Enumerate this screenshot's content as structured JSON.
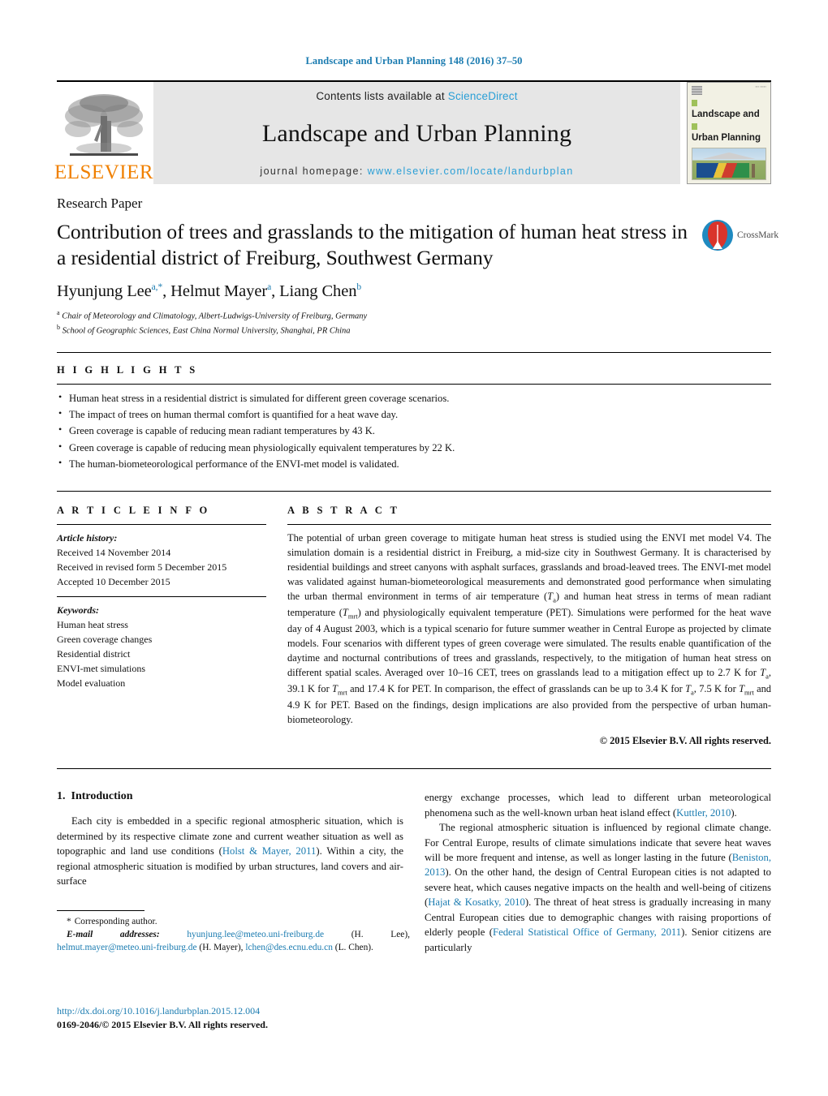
{
  "running_head": "Landscape and Urban Planning 148 (2016) 37–50",
  "masthead": {
    "publisher_logo_text": "ELSEVIER",
    "contents_prefix": "Contents lists available at ",
    "contents_link": "ScienceDirect",
    "journal_name": "Landscape and Urban Planning",
    "homepage_prefix": "journal homepage: ",
    "homepage_url": "www.elsevier.com/locate/landurbplan",
    "cover_title_line1": "Landscape and",
    "cover_title_line2": "Urban Planning"
  },
  "article": {
    "type": "Research Paper",
    "title": "Contribution of trees and grasslands to the mitigation of human heat stress in a residential district of Freiburg, Southwest Germany",
    "crossmark_label": "CrossMark",
    "authors_html": "Hyunjung Lee<sup>a,</sup><sup>*</sup>, Helmut Mayer<sup>a</sup>, Liang Chen<sup>b</sup>",
    "affiliations": [
      {
        "marker": "a",
        "text": "Chair of Meteorology and Climatology, Albert-Ludwigs-University of Freiburg, Germany"
      },
      {
        "marker": "b",
        "text": "School of Geographic Sciences, East China Normal University, Shanghai, PR China"
      }
    ]
  },
  "highlights": {
    "heading": "H I G H L I G H T S",
    "items": [
      "Human heat stress in a residential district is simulated for different green coverage scenarios.",
      "The impact of trees on human thermal comfort is quantified for a heat wave day.",
      "Green coverage is capable of reducing mean radiant temperatures by 43 K.",
      "Green coverage is capable of reducing mean physiologically equivalent temperatures by 22 K.",
      "The human-biometeorological performance of the ENVI-met model is validated."
    ]
  },
  "article_info": {
    "heading": "A R T I C L E   I N F O",
    "history_label": "Article history:",
    "history": [
      "Received 14 November 2014",
      "Received in revised form 5 December 2015",
      "Accepted 10 December 2015"
    ],
    "keywords_label": "Keywords:",
    "keywords": [
      "Human heat stress",
      "Green coverage changes",
      "Residential district",
      "ENVI-met simulations",
      "Model evaluation"
    ]
  },
  "abstract": {
    "heading": "A B S T R A C T",
    "text_html": "The potential of urban green coverage to mitigate human heat stress is studied using the ENVI met model V4. The simulation domain is a residential district in Freiburg, a mid-size city in Southwest Germany. It is characterised by residential buildings and street canyons with asphalt surfaces, grasslands and broad-leaved trees. The ENVI-met model was validated against human-biometeorological measurements and demonstrated good performance when simulating the urban thermal environment in terms of air temperature (<i>T</i><sub>a</sub>) and human heat stress in terms of mean radiant temperature (<i>T</i><sub>mrt</sub>) and physiologically equivalent temperature (PET). Simulations were performed for the heat wave day of 4 August 2003, which is a typical scenario for future summer weather in Central Europe as projected by climate models. Four scenarios with different types of green coverage were simulated. The results enable quantification of the daytime and nocturnal contributions of trees and grasslands, respectively, to the mitigation of human heat stress on different spatial scales. Averaged over 10–16 CET, trees on grasslands lead to a mitigation effect up to 2.7 K for <i>T</i><sub>a</sub>, 39.1 K for <i>T</i><sub>mrt</sub> and 17.4 K for PET. In comparison, the effect of grasslands can be up to 3.4 K for <i>T</i><sub>a</sub>, 7.5 K for <i>T</i><sub>mrt</sub> and 4.9 K for PET. Based on the findings, design implications are also provided from the perspective of urban human-biometeorology.",
    "copyright": "© 2015 Elsevier B.V. All rights reserved."
  },
  "introduction": {
    "number": "1.",
    "heading": "Introduction",
    "col_left_html": "Each city is embedded in a specific regional atmospheric situation, which is determined by its respective climate zone and current weather situation as well as topographic and land use conditions (<span class=\"ref\">Holst &amp; Mayer, 2011</span>). Within a city, the regional atmospheric situation is modified by urban structures, land covers and air-surface",
    "col_right_p1_html": "energy exchange processes, which lead to different urban meteorological phenomena such as the well-known urban heat island effect (<span class=\"ref\">Kuttler, 2010</span>).",
    "col_right_p2_html": "The regional atmospheric situation is influenced by regional climate change. For Central Europe, results of climate simulations indicate that severe heat waves will be more frequent and intense, as well as longer lasting in the future (<span class=\"ref\">Beniston, 2013</span>). On the other hand, the design of Central European cities is not adapted to severe heat, which causes negative impacts on the health and well-being of citizens (<span class=\"ref\">Hajat &amp; Kosatky, 2010</span>). The threat of heat stress is gradually increasing in many Central European cities due to demographic changes with raising proportions of elderly people (<span class=\"ref\">Federal Statistical Office of Germany, 2011</span>). Senior citizens are particularly"
  },
  "footnotes": {
    "corresponding": "Corresponding author.",
    "email_label": "E-mail addresses:",
    "emails_html": "<span class=\"ref\">hyunjung.lee@meteo.uni-freiburg.de</span> (H. Lee), <span class=\"ref\">helmut.mayer@meteo.uni-freiburg.de</span> (H. Mayer), <span class=\"ref\">lchen@des.ecnu.edu.cn</span> (L. Chen).",
    "doi": "http://dx.doi.org/10.1016/j.landurbplan.2015.12.004",
    "issn": "0169-2046/© 2015 Elsevier B.V. All rights reserved."
  },
  "colors": {
    "link_blue": "#1a7bb0",
    "elsevier_orange": "#F08000",
    "masthead_grey": "#e6e6e6"
  }
}
